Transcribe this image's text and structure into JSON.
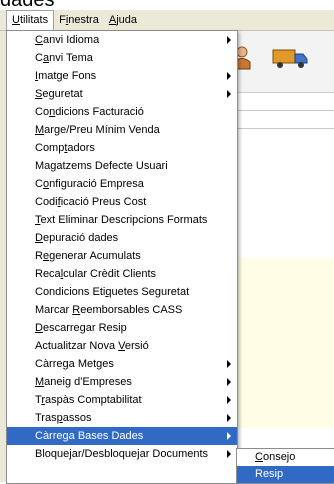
{
  "window_title_fragment": "dades",
  "menubar": {
    "items": [
      {
        "pre": "",
        "acc": "U",
        "post": "tilitats",
        "active": true
      },
      {
        "pre": "F",
        "acc": "i",
        "post": "nestra",
        "active": false
      },
      {
        "pre": "",
        "acc": "A",
        "post": "juda",
        "active": false
      }
    ]
  },
  "toolbar": {
    "icons": [
      "person-icon",
      "truck-icon"
    ]
  },
  "menu": {
    "items": [
      {
        "pre": "",
        "acc": "C",
        "post": "anvi Idioma",
        "submenu": true
      },
      {
        "pre": "C",
        "acc": "a",
        "post": "nvi Tema",
        "submenu": false
      },
      {
        "pre": "",
        "acc": "I",
        "post": "matge Fons",
        "submenu": true
      },
      {
        "pre": "",
        "acc": "S",
        "post": "eguretat",
        "submenu": true
      },
      {
        "pre": "Co",
        "acc": "n",
        "post": "dicions Facturació",
        "submenu": false
      },
      {
        "pre": "",
        "acc": "M",
        "post": "arge/Preu Mínim Venda",
        "submenu": false
      },
      {
        "pre": "Comp",
        "acc": "t",
        "post": "adors",
        "submenu": false
      },
      {
        "pre": "Ma",
        "acc": "g",
        "post": "atzems Defecte Usuari",
        "submenu": false
      },
      {
        "pre": "C",
        "acc": "o",
        "post": "nfiguració Empresa",
        "submenu": false
      },
      {
        "pre": "Codi",
        "acc": "f",
        "post": "icació Preus Cost",
        "submenu": false
      },
      {
        "pre": "",
        "acc": "T",
        "post": "ext Eliminar Descripcions Formats",
        "submenu": false
      },
      {
        "pre": "",
        "acc": "D",
        "post": "epuració dades",
        "submenu": false
      },
      {
        "pre": "R",
        "acc": "e",
        "post": "generar Acumulats",
        "submenu": false
      },
      {
        "pre": "Reca",
        "acc": "l",
        "post": "cular Crèdit Clients",
        "submenu": false
      },
      {
        "pre": "Condicions Eti",
        "acc": "q",
        "post": "uetes Seguretat",
        "submenu": false
      },
      {
        "pre": "Marcar ",
        "acc": "R",
        "post": "eemborsables CASS",
        "submenu": false
      },
      {
        "pre": "",
        "acc": "D",
        "post": "escarregar Resip",
        "submenu": false
      },
      {
        "pre": "Actualitzar Nova ",
        "acc": "V",
        "post": "ersió",
        "submenu": false
      },
      {
        "pre": "Càrre",
        "acc": "g",
        "post": "a Metges",
        "submenu": true
      },
      {
        "pre": "",
        "acc": "M",
        "post": "aneig d'Empreses",
        "submenu": true
      },
      {
        "pre": "T",
        "acc": "r",
        "post": "aspàs Comptabilitat",
        "submenu": true
      },
      {
        "pre": "Tras",
        "acc": "p",
        "post": "assos",
        "submenu": true
      },
      {
        "pre": "Càrre",
        "acc": "g",
        "post": "a Bases Dades",
        "submenu": true,
        "selected": true
      },
      {
        "pre": "Bloquejar/Desbloquejar Documents",
        "acc": "",
        "post": "",
        "submenu": true
      }
    ]
  },
  "submenu": {
    "items": [
      {
        "pre": "",
        "acc": "C",
        "post": "onsejo",
        "selected": false
      },
      {
        "pre": "Resip",
        "acc": "",
        "post": "",
        "selected": true
      }
    ]
  }
}
